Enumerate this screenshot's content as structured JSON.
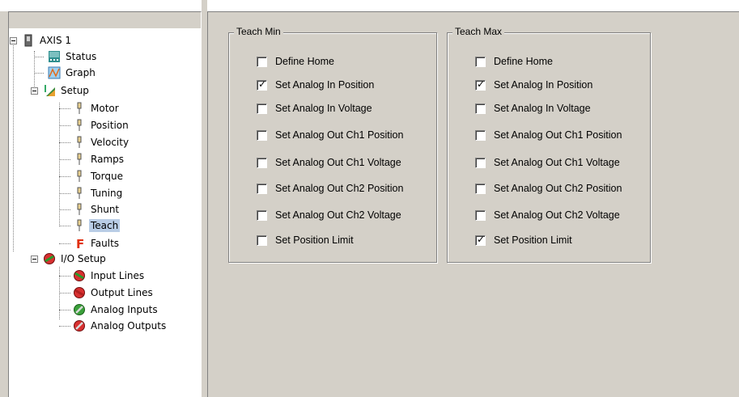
{
  "tree": {
    "root": {
      "label": "AXIS 1",
      "icon": "drive-icon"
    },
    "items": [
      {
        "label": "Status",
        "icon": "status-icon"
      },
      {
        "label": "Graph",
        "icon": "graph-icon"
      },
      {
        "label": "Setup",
        "icon": "setup-icon"
      },
      {
        "label": "Motor",
        "icon": "pin-icon"
      },
      {
        "label": "Position",
        "icon": "pin-icon"
      },
      {
        "label": "Velocity",
        "icon": "pin-icon"
      },
      {
        "label": "Ramps",
        "icon": "pin-icon"
      },
      {
        "label": "Torque",
        "icon": "pin-icon"
      },
      {
        "label": "Tuning",
        "icon": "pin-icon"
      },
      {
        "label": "Shunt",
        "icon": "pin-icon"
      },
      {
        "label": "Teach",
        "icon": "pin-icon",
        "selected": true
      },
      {
        "label": "Faults",
        "icon": "faults-icon"
      },
      {
        "label": "I/O Setup",
        "icon": "io-icon"
      },
      {
        "label": "Input Lines",
        "icon": "input-lines-icon"
      },
      {
        "label": "Output Lines",
        "icon": "output-lines-icon"
      },
      {
        "label": "Analog Inputs",
        "icon": "analog-inputs-icon"
      },
      {
        "label": "Analog Outputs",
        "icon": "analog-outputs-icon"
      }
    ]
  },
  "teach_min": {
    "title": "Teach Min",
    "options": [
      {
        "label": "Define Home",
        "checked": false
      },
      {
        "label": "Set Analog In Position",
        "checked": true
      },
      {
        "label": "Set Analog In Voltage",
        "checked": false
      },
      {
        "label": "Set Analog Out Ch1 Position",
        "checked": false
      },
      {
        "label": "Set Analog Out Ch1 Voltage",
        "checked": false
      },
      {
        "label": "Set Analog Out Ch2 Position",
        "checked": false
      },
      {
        "label": "Set Analog Out Ch2 Voltage",
        "checked": false
      },
      {
        "label": "Set Position Limit",
        "checked": false
      }
    ]
  },
  "teach_max": {
    "title": "Teach Max",
    "options": [
      {
        "label": "Define Home",
        "checked": false
      },
      {
        "label": "Set Analog In Position",
        "checked": true
      },
      {
        "label": "Set Analog In Voltage",
        "checked": false
      },
      {
        "label": "Set Analog Out Ch1 Position",
        "checked": false
      },
      {
        "label": "Set Analog Out Ch1 Voltage",
        "checked": false
      },
      {
        "label": "Set Analog Out Ch2 Position",
        "checked": false
      },
      {
        "label": "Set Analog Out Ch2 Voltage",
        "checked": false
      },
      {
        "label": "Set Position Limit",
        "checked": true
      }
    ]
  }
}
